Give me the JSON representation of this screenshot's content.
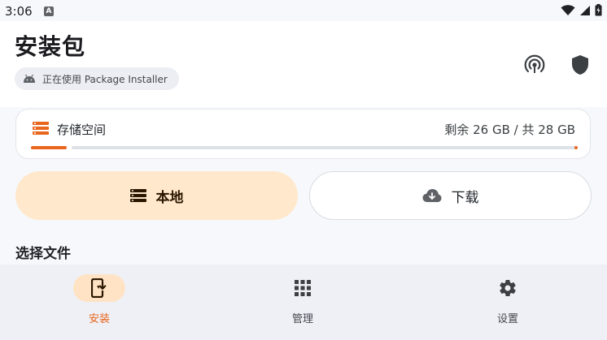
{
  "status_bar": {
    "time": "3:06",
    "notification_badge": "A"
  },
  "header": {
    "title": "安装包",
    "installer_chip": "正在使用 Package Installer"
  },
  "storage": {
    "label": "存储空间",
    "value": "剩余 26 GB / 共 28 GB",
    "used_fraction": 0.07
  },
  "source_tabs": {
    "local": "本地",
    "download": "下载",
    "selected": "local"
  },
  "section_title": "选择文件",
  "bottom_nav": {
    "items": [
      {
        "label": "安装",
        "icon": "install-phone-icon",
        "active": true
      },
      {
        "label": "管理",
        "icon": "grid-apps-icon",
        "active": false
      },
      {
        "label": "设置",
        "icon": "gear-icon",
        "active": false
      }
    ]
  },
  "colors": {
    "accent": "#e9661e",
    "accent_container": "#ffe8cc",
    "nav_background": "#eef0f5"
  }
}
